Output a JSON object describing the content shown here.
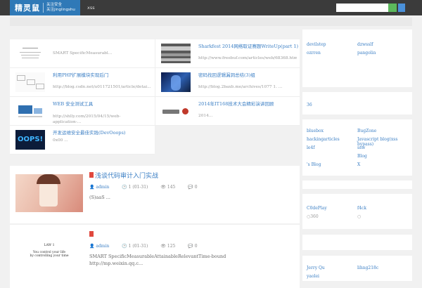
{
  "header": {
    "logo_main": "精灵鼠",
    "logo_sub1": "关注安全",
    "logo_sub2": "关注jinglingshu",
    "nav_item": "xss",
    "search_placeholder": ""
  },
  "recommended": [
    {
      "title": "",
      "desc": "SMART SpecificMeasurabl..."
    },
    {
      "title": "Sharkfest 2014网络取证赛题WriteUp(part 1)",
      "desc": "http://www.freebuf.com/articles/web/68368.htm"
    },
    {
      "title": "利用PHP扩展模块实现后门",
      "desc": "http://blog.csdn.net/u011721501/article/detai..."
    },
    {
      "title": "密码找回逻辑漏洞总结(3)组",
      "desc": "http://blog.2baxb.me/archives/1077 1. ..."
    },
    {
      "title": "WEB 安全测试工具",
      "desc": "http://shlly.com/2015/04/15/web-application-..."
    },
    {
      "title": "2014年IT168技术大会精彩演讲回顾",
      "desc": "2014..."
    },
    {
      "title": "开发运维安全最佳实践(DevOoops)",
      "desc": "0x00 ..."
    }
  ],
  "thumb_texts": {
    "notes_line1": "",
    "notes_line2": "",
    "oops": "OOPS!"
  },
  "posts": [
    {
      "title": "浅谈代码审计入门实战",
      "author": "admin",
      "date": "1 (01-31)",
      "views": "145",
      "comments": "0",
      "desc": "(S)aaS ..."
    },
    {
      "title": "",
      "author": "admin",
      "date": "1 (01-31)",
      "views": "125",
      "comments": "0",
      "desc": "SMART SpecificMeasurableAttainableRelevantTime-bound http://mp.weixin.qq.c...",
      "thumb_law": "LAW 1",
      "thumb_line1": "You control your life",
      "thumb_line2": "by controlling your time"
    }
  ],
  "sidebar": {
    "tags": [
      "devilstep",
      "dzwsslf",
      "ozrren",
      "pangolin"
    ],
    "count": "36",
    "links": [
      "bluebox",
      "BugZone",
      "hackingarticles",
      "Javascript blog(xss bypass)",
      "le4f",
      "ssw",
      "Blog",
      "'s Blog",
      "X"
    ],
    "friends": [
      "C0dePlay",
      "f4ck",
      "○360",
      "○"
    ],
    "members": [
      "Jerry Qu",
      "lihng218c",
      "yaolei"
    ]
  },
  "colors": {
    "accent": "#2f79b7",
    "link": "#3a7ec4",
    "topbar": "#3b3b3b"
  }
}
